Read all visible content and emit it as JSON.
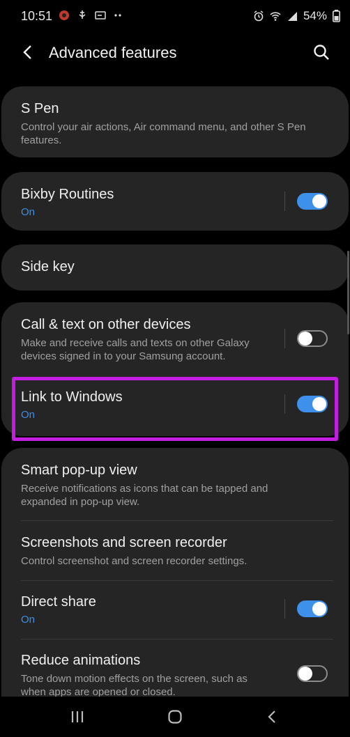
{
  "status_bar": {
    "time": "10:51",
    "battery": "54%"
  },
  "header": {
    "title": "Advanced features"
  },
  "items": {
    "s_pen": {
      "title": "S Pen",
      "subtitle": "Control your air actions, Air command menu, and other S Pen features."
    },
    "bixby": {
      "title": "Bixby Routines",
      "status": "On",
      "enabled": true
    },
    "side_key": {
      "title": "Side key"
    },
    "call_text": {
      "title": "Call & text on other devices",
      "subtitle": "Make and receive calls and texts on other Galaxy devices signed in to your Samsung account.",
      "enabled": false
    },
    "link_windows": {
      "title": "Link to Windows",
      "status": "On",
      "enabled": true
    },
    "smart_popup": {
      "title": "Smart pop-up view",
      "subtitle": "Receive notifications as icons that can be tapped and expanded in pop-up view."
    },
    "screenshots": {
      "title": "Screenshots and screen recorder",
      "subtitle": "Control screenshot and screen recorder settings."
    },
    "direct_share": {
      "title": "Direct share",
      "status": "On",
      "enabled": true
    },
    "reduce_anim": {
      "title": "Reduce animations",
      "subtitle": "Tone down motion effects on the screen, such as when apps are opened or closed.",
      "enabled": false
    }
  },
  "colors": {
    "accent": "#3e91ea",
    "highlight": "#c21de0",
    "card": "#252525"
  }
}
